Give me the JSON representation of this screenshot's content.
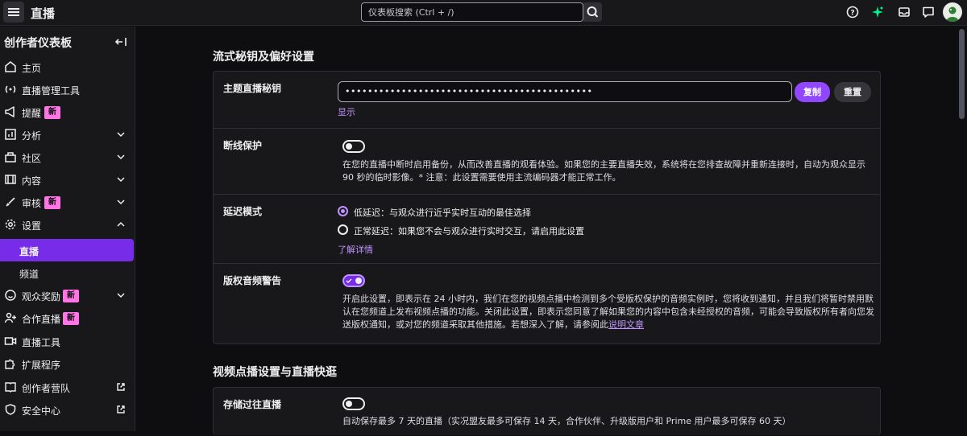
{
  "topbar": {
    "title": "直播",
    "search_placeholder": "仪表板搜索 (Ctrl + /)"
  },
  "sidebar": {
    "title": "创作者仪表板",
    "items": [
      {
        "label": "主页"
      },
      {
        "label": "直播管理工具"
      },
      {
        "label": "提醒",
        "badge": "新"
      },
      {
        "label": "分析"
      },
      {
        "label": "社区"
      },
      {
        "label": "内容"
      },
      {
        "label": "审核",
        "badge": "新"
      },
      {
        "label": "设置"
      },
      {
        "label": "直播"
      },
      {
        "label": "频道"
      },
      {
        "label": "观众奖励",
        "badge": "新"
      },
      {
        "label": "合作直播",
        "badge": "新"
      },
      {
        "label": "直播工具"
      },
      {
        "label": "扩展程序"
      },
      {
        "label": "创作者营队"
      },
      {
        "label": "安全中心"
      }
    ]
  },
  "stream_key_section": {
    "heading": "流式秘钥及偏好设置",
    "key_label": "主题直播秘钥",
    "key_value": "••••••••••••••••••••••••••••••••••••••••••••",
    "copy_label": "复制",
    "reset_label": "重置",
    "show_label": "显示",
    "disconnect_label": "断线保护",
    "disconnect_desc": "在您的直播中断时启用备份，从而改善直播的观看体验。如果您的主要直播失效，系统将在您排查故障并重新连接时，自动为观众显示 90 秒的临时影像。* 注意：此设置需要使用主流编码器才能正常工作。",
    "latency_label": "延迟模式",
    "latency_low": "低延迟：与观众进行近乎实时互动的最佳选择",
    "latency_normal": "正常延迟：如果您不会与观众进行实时交互，请启用此设置",
    "learn_more": "了解详情",
    "copyright_label": "版权音频警告",
    "copyright_desc": "开启此设置，即表示在 24 小时内，我们在您的视频点播中检测到多个受版权保护的音频实例时，您将收到通知，并且我们将暂时禁用默认在您频道上发布视频点播的功能。关闭此设置，即表示您同意了解如果您的内容中包含未经授权的音频，可能会导致版权所有者向您发送版权通知，或对您的频道采取其他措施。若想深入了解，请参阅此",
    "copyright_link": "说明文章"
  },
  "vod_section": {
    "heading": "视频点播设置与直播快逛",
    "store_label": "存储过往直播",
    "store_desc": "自动保存最多 7 天的直播（实况盟友最多可保存 14 天，合作伙伴、升级版用户和 Prime 用户最多可保存 60 天）"
  },
  "toggles": {
    "disconnect_on": false,
    "copyright_on": true,
    "store_on": false
  },
  "colors": {
    "accent": "#9147ff",
    "badge": "#ff75e6",
    "link": "#bf94ff"
  }
}
